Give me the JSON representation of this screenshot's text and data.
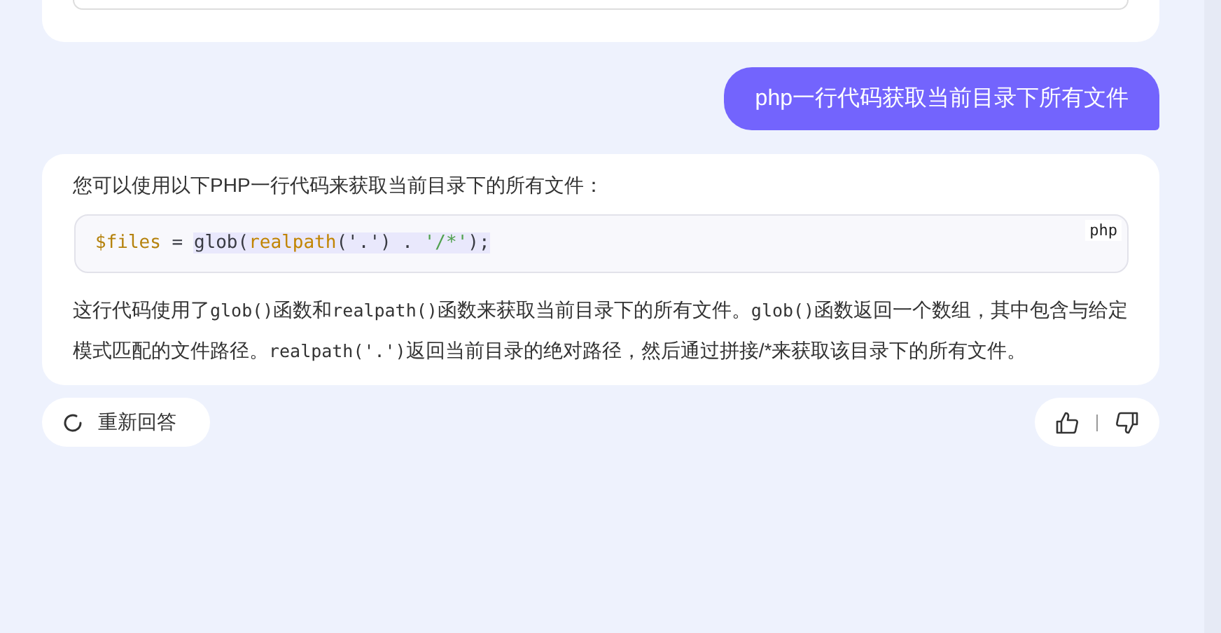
{
  "user_message": {
    "text": "php一行代码获取当前目录下所有文件"
  },
  "answer": {
    "intro": "您可以使用以下PHP一行代码来获取当前目录下的所有文件：",
    "code_block": {
      "language": "php",
      "tokens": [
        {
          "text": "$files",
          "color": "#b5820c",
          "highlighted": false
        },
        {
          "text": " = ",
          "color": "#383a42",
          "highlighted": false
        },
        {
          "text": "glob(",
          "color": "#383a42",
          "highlighted": true
        },
        {
          "text": "realpath",
          "color": "#c18401",
          "highlighted": true
        },
        {
          "text": "('.') . ",
          "color": "#383a42",
          "highlighted": true
        },
        {
          "text": "'/*'",
          "color": "#50a14f",
          "highlighted": true
        },
        {
          "text": ");",
          "color": "#383a42",
          "highlighted": true
        }
      ]
    },
    "explanation": [
      {
        "kind": "text",
        "text": "这行代码使用了"
      },
      {
        "kind": "code",
        "text": "glob()"
      },
      {
        "kind": "text",
        "text": "函数和"
      },
      {
        "kind": "code",
        "text": "realpath()"
      },
      {
        "kind": "text",
        "text": "函数来获取当前目录下的所有文件。"
      },
      {
        "kind": "code",
        "text": "glob()"
      },
      {
        "kind": "text",
        "text": "函数返回一个数组，其中包含与给定模式匹配的文件路径。"
      },
      {
        "kind": "code",
        "text": "realpath('.')"
      },
      {
        "kind": "text",
        "text": "返回当前目录的绝对路径，然后通过拼接/*来获取该目录下的所有文件。"
      }
    ]
  },
  "regenerate_button": {
    "label": "重新回答"
  }
}
